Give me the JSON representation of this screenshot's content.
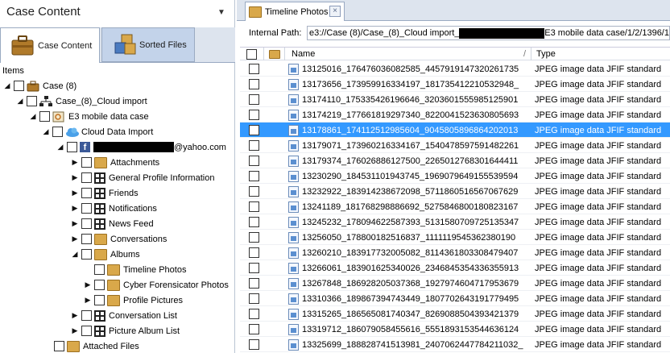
{
  "left_panel": {
    "title": "Case Content",
    "pin_icon": "pin-icon",
    "tabs": [
      {
        "label": "Case Content",
        "icon": "briefcase-icon"
      },
      {
        "label": "Sorted Files",
        "icon": "boxes-icon"
      }
    ],
    "items_label": "Items",
    "tree": {
      "case": "Case (8)",
      "cloud_import": "Case_(8)_Cloud import",
      "mobile_case": "E3 mobile data case",
      "cloud_data_import": "Cloud Data Import",
      "account_suffix": "@yahoo.com",
      "attachments": "Attachments",
      "general_profile": "General Profile Information",
      "friends": "Friends",
      "notifications": "Notifications",
      "news_feed": "News Feed",
      "conversations": "Conversations",
      "albums": "Albums",
      "timeline_photos": "Timeline Photos",
      "cyber_forensicator": "Cyber Forensicator Photos",
      "profile_pictures": "Profile Pictures",
      "conversation_list": "Conversation List",
      "picture_album_list": "Picture Album List",
      "attached_files": "Attached Files"
    }
  },
  "right_panel": {
    "tab_label": "Timeline Photos",
    "close_glyph": "×",
    "internal_path_label": "Internal Path:",
    "internal_path_prefix": "e3://Case (8)/Case_(8)_Cloud import_",
    "internal_path_suffix": "E3 mobile data case/1/2/1396/1",
    "columns": {
      "name": "Name",
      "sort_mark": "/",
      "type": "Type"
    },
    "rows": [
      {
        "name": "13125016_176476036082585_4457919147320261735",
        "type": "JPEG image data JFIF standard"
      },
      {
        "name": "13173656_173959916334197_181735412210532948_",
        "type": "JPEG image data JFIF standard"
      },
      {
        "name": "13174110_175335426196646_3203601555985125901",
        "type": "JPEG image data JFIF standard"
      },
      {
        "name": "13174219_177661819297340_8220041523630805693",
        "type": "JPEG image data JFIF standard"
      },
      {
        "name": "13178861_174112512985604_9045805896864202013",
        "type": "JPEG image data JFIF standard",
        "selected": true
      },
      {
        "name": "13179071_173960216334167_1540478597591482261",
        "type": "JPEG image data JFIF standard"
      },
      {
        "name": "13179374_176026886127500_2265012768301644411",
        "type": "JPEG image data JFIF standard"
      },
      {
        "name": "13230290_184531101943745_1969079649155539594",
        "type": "JPEG image data JFIF standard"
      },
      {
        "name": "13232922_183914238672098_5711860516567067629",
        "type": "JPEG image data JFIF standard"
      },
      {
        "name": "13241189_181768298886692_5275846800180823167",
        "type": "JPEG image data JFIF standard"
      },
      {
        "name": "13245232_178094622587393_5131580709725135347",
        "type": "JPEG image data JFIF standard"
      },
      {
        "name": "13256050_178800182516837_1111119545362380190",
        "type": "JPEG image data JFIF standard"
      },
      {
        "name": "13260210_183917732005082_8114361803308479407",
        "type": "JPEG image data JFIF standard"
      },
      {
        "name": "13266061_183901625340026_2346845354336355913",
        "type": "JPEG image data JFIF standard"
      },
      {
        "name": "13267848_186928205037368_1927974604717953679",
        "type": "JPEG image data JFIF standard"
      },
      {
        "name": "13310366_189867394743449_1807702643191779495",
        "type": "JPEG image data JFIF standard"
      },
      {
        "name": "13315265_186565081740347_8269088504393421379",
        "type": "JPEG image data JFIF standard"
      },
      {
        "name": "13319712_186079058455616_5551893153544636124",
        "type": "JPEG image data JFIF standard"
      },
      {
        "name": "13325699_188828741513981_2407062447784211032_",
        "type": "JPEG image data JFIF standard"
      }
    ]
  },
  "colors": {
    "selection": "#3399ff",
    "tab_strip": "#dde4ee",
    "facebook": "#3b5998"
  }
}
